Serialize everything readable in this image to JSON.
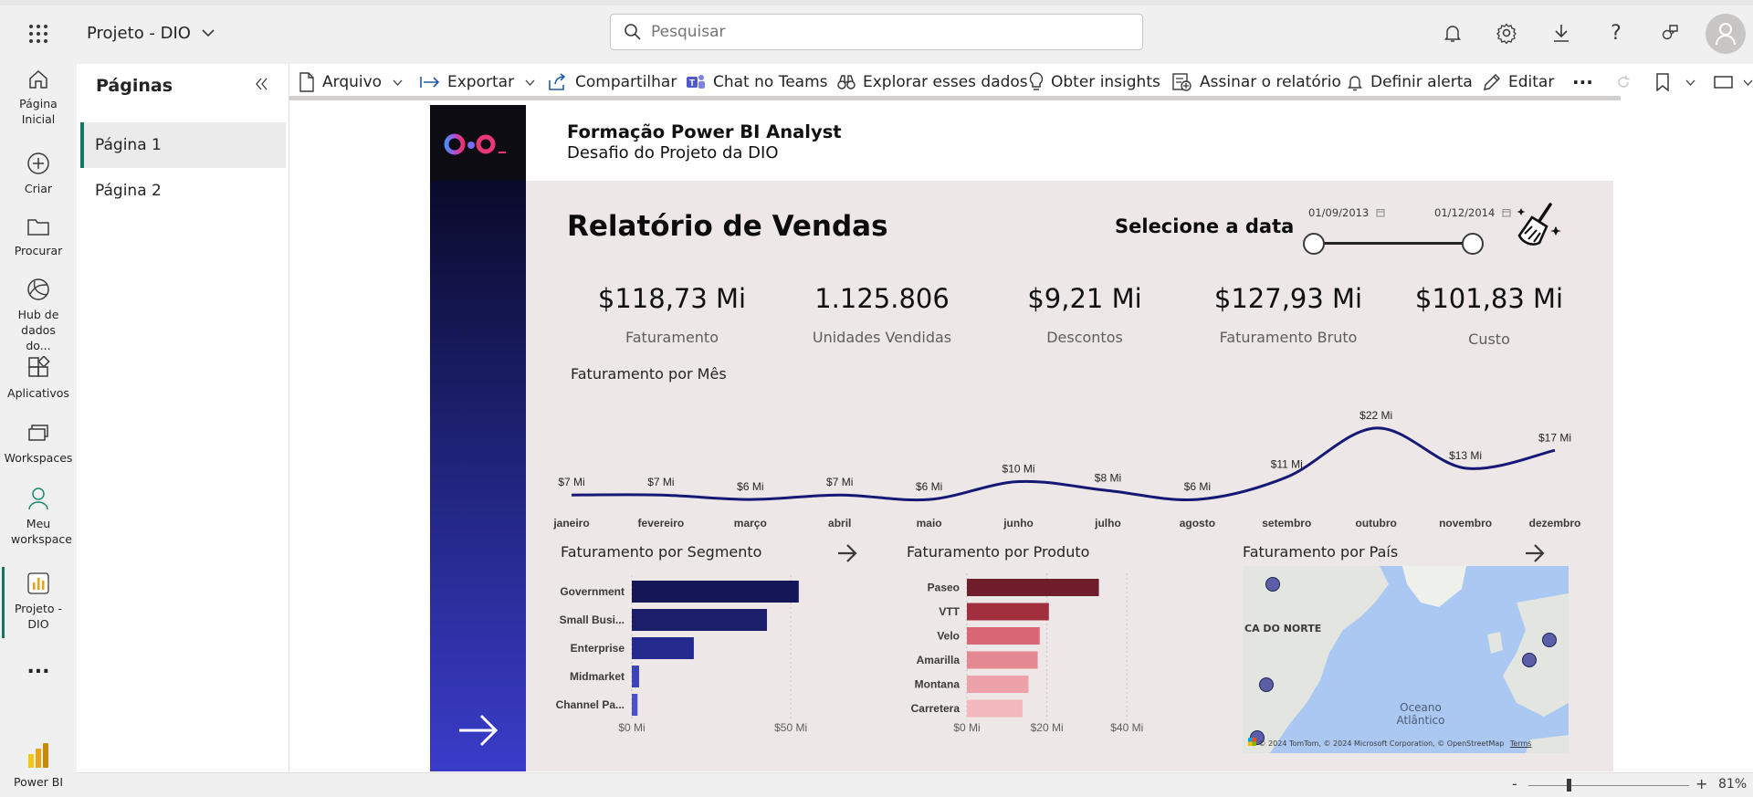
{
  "app": {
    "workspace_name": "Projeto - DIO",
    "search_placeholder": "Pesquisar"
  },
  "rail": {
    "home": "Página Inicial",
    "create": "Criar",
    "browse": "Procurar",
    "datahub": "Hub de dados do...",
    "apps": "Aplicativos",
    "workspaces": "Workspaces",
    "my_workspace": "Meu workspace",
    "project": "Projeto - DIO",
    "more": "...",
    "powerbi": "Power BI"
  },
  "pages_panel": {
    "title": "Páginas",
    "items": [
      {
        "label": "Página 1",
        "selected": true
      },
      {
        "label": "Página 2",
        "selected": false
      }
    ]
  },
  "toolbar": {
    "file": "Arquivo",
    "export": "Exportar",
    "share": "Compartilhar",
    "teams": "Chat no Teams",
    "explore": "Explorar esses dados",
    "insights": "Obter insights",
    "subscribe": "Assinar o relatório",
    "alert": "Definir alerta",
    "edit": "Editar",
    "more": "···"
  },
  "report": {
    "header_title": "Formação Power BI Analyst",
    "header_subtitle": "Desafio do Projeto da DIO",
    "main_title": "Relatório de Vendas",
    "date_label": "Selecione a data",
    "date_start": "01/09/2013",
    "date_end": "01/12/2014",
    "kpis": [
      {
        "value": "$118,73 Mi",
        "label": "Faturamento"
      },
      {
        "value": "1.125.806",
        "label": "Unidades Vendidas"
      },
      {
        "value": "$9,21 Mi",
        "label": "Descontos"
      },
      {
        "value": "$127,93 Mi",
        "label": "Faturamento Bruto"
      },
      {
        "value": "$101,83 Mi",
        "label": "Custo"
      }
    ]
  },
  "colors": {
    "line": "#151874",
    "segment_bars": [
      "#141658",
      "#1b1e6b",
      "#252b8e",
      "#3d44b8",
      "#4a51c4"
    ],
    "product_bars": [
      "#6f1d2a",
      "#a12f3d",
      "#d96675",
      "#e48891",
      "#eda1a8",
      "#f2b8bd"
    ],
    "map_water": "#aac8f1",
    "map_land": "#e4e6e2"
  },
  "chart_data": [
    {
      "type": "line",
      "title": "Faturamento por Mês",
      "categories": [
        "janeiro",
        "fevereiro",
        "março",
        "abril",
        "maio",
        "junho",
        "julho",
        "agosto",
        "setembro",
        "outubro",
        "novembro",
        "dezembro"
      ],
      "values": [
        7,
        7,
        6,
        7,
        6,
        10,
        8,
        6,
        11,
        22,
        13,
        17
      ],
      "labels": [
        "$7 Mi",
        "$7 Mi",
        "$6 Mi",
        "$7 Mi",
        "$6 Mi",
        "$10 Mi",
        "$8 Mi",
        "$6 Mi",
        "$11 Mi",
        "$22 Mi",
        "$13 Mi",
        "$17 Mi"
      ]
    },
    {
      "type": "bar",
      "title": "Faturamento por Segmento",
      "categories": [
        "Government",
        "Small Busi...",
        "Enterprise",
        "Midmarket",
        "Channel Pa..."
      ],
      "values": [
        52.5,
        42.5,
        19.5,
        2.3,
        1.8
      ],
      "xticks": [
        "$0 Mi",
        "$50 Mi"
      ],
      "xlim": [
        0,
        58
      ]
    },
    {
      "type": "bar",
      "title": "Faturamento por Produto",
      "categories": [
        "Paseo",
        "VTT",
        "Velo",
        "Amarilla",
        "Montana",
        "Carretera"
      ],
      "values": [
        33.0,
        20.5,
        18.2,
        17.7,
        15.4,
        13.9
      ],
      "xticks": [
        "$0 Mi",
        "$20 Mi",
        "$40 Mi"
      ],
      "xlim": [
        0,
        42
      ]
    }
  ],
  "map": {
    "title": "Faturamento por País",
    "region_label": "CA DO NORTE",
    "ocean_label": "Oceano Atlântico",
    "attribution": "© 2024 TomTom, © 2024 Microsoft Corporation, © OpenStreetMap",
    "terms": "Terms",
    "markers": [
      "Canada",
      "United States",
      "Mexico",
      "France",
      "Germany"
    ]
  },
  "status": {
    "zoom_minus": "-",
    "zoom_plus": "+",
    "zoom": "81%"
  }
}
